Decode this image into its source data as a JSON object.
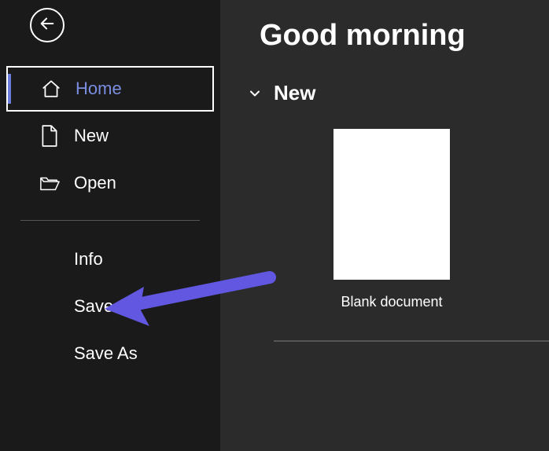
{
  "sidebar": {
    "back_icon": "back",
    "items": [
      {
        "label": "Home",
        "icon": "home",
        "selected": true
      },
      {
        "label": "New",
        "icon": "document",
        "selected": false
      },
      {
        "label": "Open",
        "icon": "folder",
        "selected": false
      }
    ],
    "secondary_items": [
      {
        "label": "Info"
      },
      {
        "label": "Save"
      },
      {
        "label": "Save As"
      }
    ]
  },
  "main": {
    "greeting": "Good morning",
    "section_new_label": "New",
    "template_blank_label": "Blank document"
  },
  "annotation": {
    "arrow_color": "#6157e0"
  }
}
